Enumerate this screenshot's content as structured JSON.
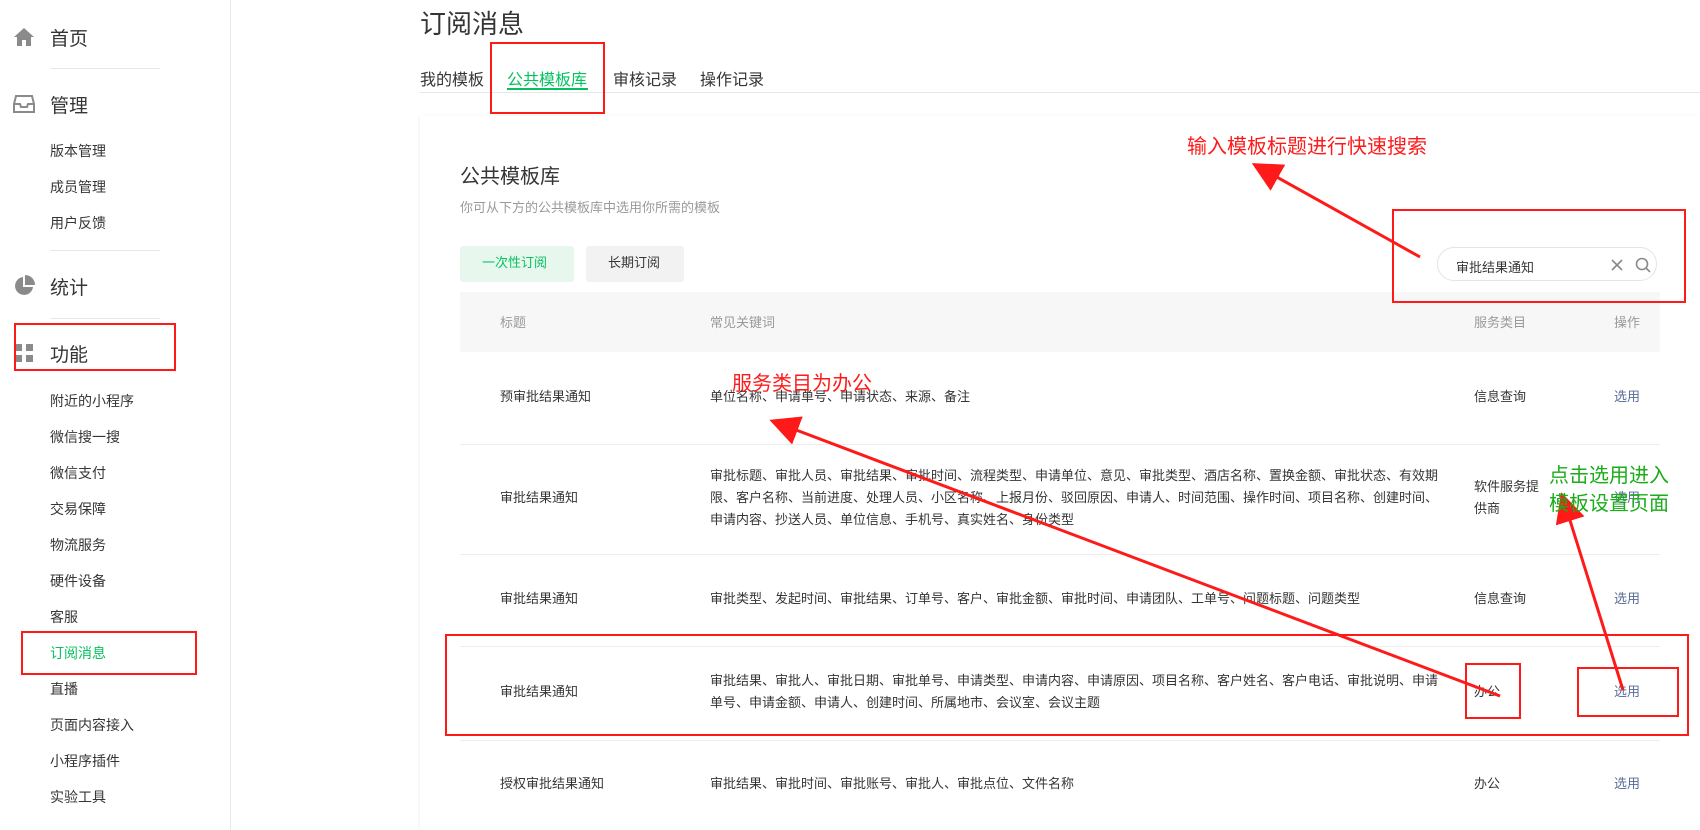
{
  "sidebar": {
    "home_label": "首页",
    "manage_label": "管理",
    "manage_items": [
      "版本管理",
      "成员管理",
      "用户反馈"
    ],
    "stats_label": "统计",
    "func_label": "功能",
    "func_items": [
      "附近的小程序",
      "微信搜一搜",
      "微信支付",
      "交易保障",
      "物流服务",
      "硬件设备",
      "客服",
      "订阅消息",
      "直播",
      "页面内容接入",
      "小程序插件",
      "实验工具"
    ],
    "active_item": "订阅消息"
  },
  "page": {
    "title": "订阅消息",
    "tabs": [
      "我的模板",
      "公共模板库",
      "审核记录",
      "操作记录"
    ],
    "active_tab": "公共模板库"
  },
  "card": {
    "title": "公共模板库",
    "subtitle": "你可从下方的公共模板库中选用你所需的模板",
    "type_buttons": [
      "一次性订阅",
      "长期订阅"
    ],
    "search_value": "审批结果通知"
  },
  "table": {
    "headers": [
      "标题",
      "常见关键词",
      "服务类目",
      "操作"
    ],
    "rows": [
      {
        "title": "预审批结果通知",
        "keywords": "单位名称、申请单号、申请状态、来源、备注",
        "category": "信息查询",
        "action": "选用"
      },
      {
        "title": "审批结果通知",
        "keywords": "审批标题、审批人员、审批结果、审批时间、流程类型、申请单位、意见、审批类型、酒店名称、置换金额、审批状态、有效期限、客户名称、当前进度、处理人员、小区名称、上报月份、驳回原因、申请人、时间范围、操作时间、项目名称、创建时间、申请内容、抄送人员、单位信息、手机号、真实姓名、身份类型",
        "category": "软件服务提供商",
        "action": "选用"
      },
      {
        "title": "审批结果通知",
        "keywords": "审批类型、发起时间、审批结果、订单号、客户、审批金额、审批时间、申请团队、工单号、问题标题、问题类型",
        "category": "信息查询",
        "action": "选用"
      },
      {
        "title": "审批结果通知",
        "keywords": "审批结果、审批人、审批日期、审批单号、申请类型、申请内容、申请原因、项目名称、客户姓名、客户电话、审批说明、申请单号、申请金额、申请人、创建时间、所属地市、会议室、会议主题",
        "category": "办公",
        "action": "选用"
      },
      {
        "title": "授权审批结果通知",
        "keywords": "审批结果、审批时间、审批账号、审批人、审批点位、文件名称",
        "category": "办公",
        "action": "选用"
      }
    ]
  },
  "annotations": {
    "search_tip": "输入模板标题进行快速搜索",
    "category_tip": "服务类目为办公",
    "select_tip_line1": "点击选用进入",
    "select_tip_line2": "模板设置页面",
    "red": "#ff1a1a",
    "green": "#1aad19"
  },
  "colors": {
    "brand_green": "#07c160",
    "link_blue": "#576b95"
  }
}
